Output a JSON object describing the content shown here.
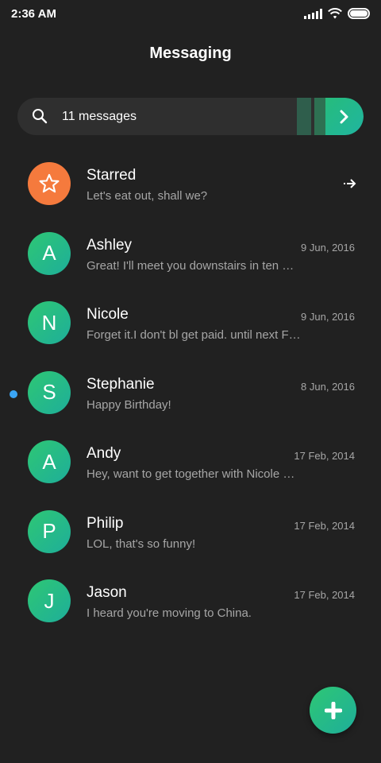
{
  "status_bar": {
    "time": "2:36 AM",
    "icons": [
      "signal-icon",
      "wifi-icon",
      "battery-icon"
    ]
  },
  "header": {
    "title": "Messaging"
  },
  "search": {
    "text": "11 messages",
    "icon": "search-icon",
    "go_icon": "chevron-right-icon"
  },
  "colors": {
    "background": "#212121",
    "accent_green": "#26bc7c",
    "accent_teal": "#20b5a0",
    "starred_orange": "#f57a3d",
    "unread_blue": "#3aa5f5",
    "secondary_text": "#a6a6a6"
  },
  "threads": [
    {
      "name": "Starred",
      "preview": "Let's eat out, shall we?",
      "date": "",
      "avatar": "star-icon",
      "unread": false
    },
    {
      "name": "Ashley",
      "preview": "Great! I'll meet you downstairs in ten …",
      "date": "9 Jun, 2016",
      "avatar": "A",
      "unread": false
    },
    {
      "name": "Nicole",
      "preview": "Forget it.I don't bl get paid. until next F…",
      "date": "9 Jun, 2016",
      "avatar": "N",
      "unread": false
    },
    {
      "name": "Stephanie",
      "preview": "Happy Birthday!",
      "date": "8 Jun, 2016",
      "avatar": "S",
      "unread": true
    },
    {
      "name": "Andy",
      "preview": "Hey, want to get together with Nicole …",
      "date": "17 Feb, 2014",
      "avatar": "A",
      "unread": false
    },
    {
      "name": "Philip",
      "preview": "LOL, that's so funny!",
      "date": "17 Feb, 2014",
      "avatar": "P",
      "unread": false
    },
    {
      "name": "Jason",
      "preview": "I heard you're moving to China.",
      "date": "17 Feb, 2014",
      "avatar": "J",
      "unread": false
    }
  ],
  "fab": {
    "icon": "plus-icon"
  }
}
